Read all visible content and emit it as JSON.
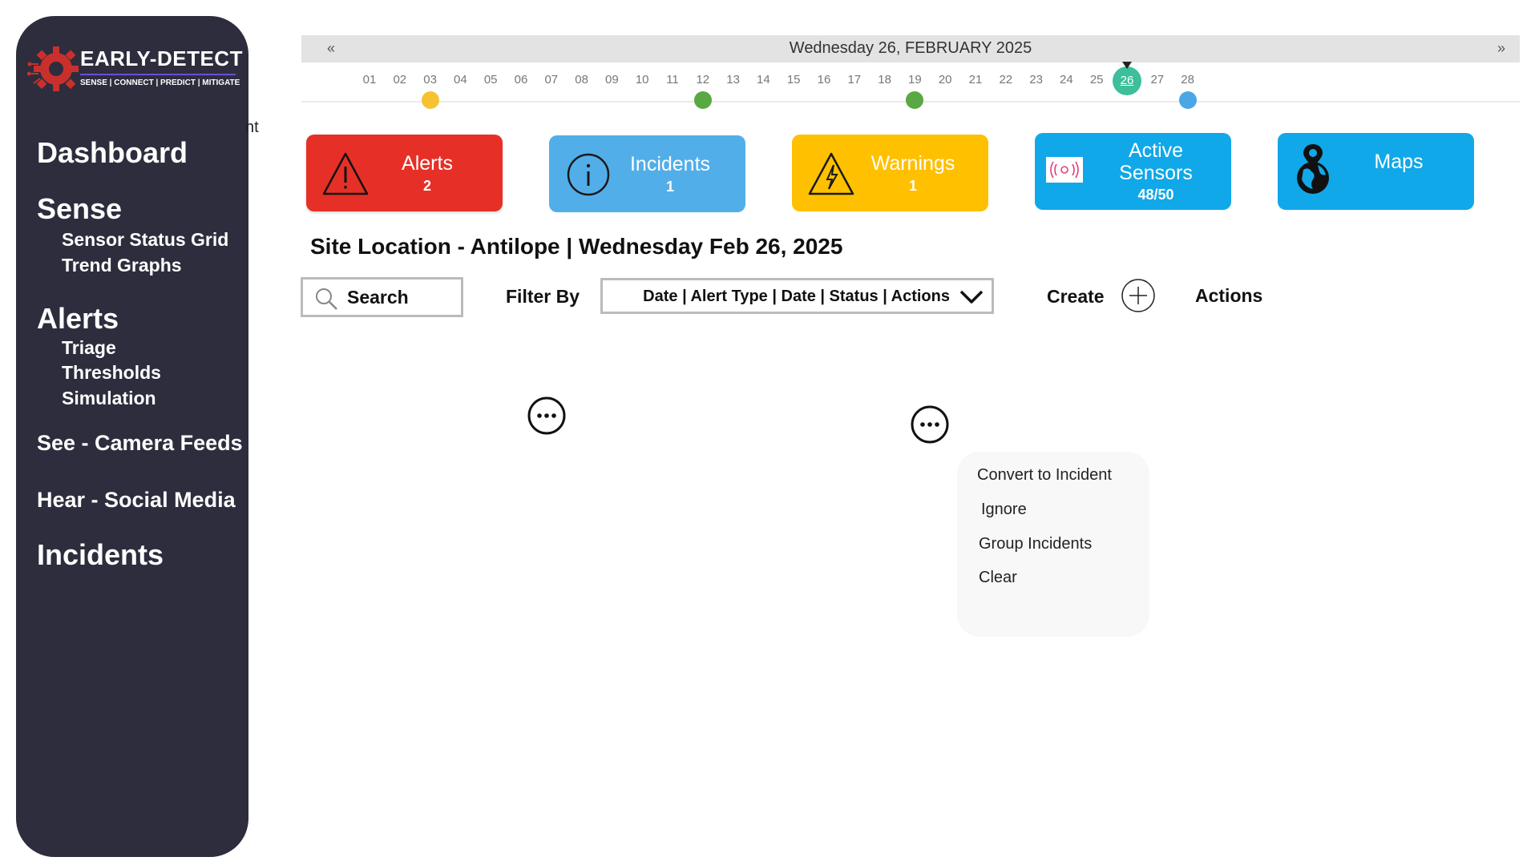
{
  "sidebar": {
    "brand": "EARLY-DETECT",
    "tagline": "SENSE | CONNECT | PREDICT | MITIGATE",
    "dashboard": "Dashboard",
    "sense": {
      "label": "Sense",
      "items": [
        "Sensor Status Grid",
        "Trend Graphs"
      ]
    },
    "alerts": {
      "label": "Alerts",
      "items": [
        "Triage",
        "Thresholds",
        "Simulation"
      ]
    },
    "see": "See - Camera Feeds",
    "hear": "Hear - Social Media",
    "incidents": "Incidents"
  },
  "stray_text": "nt",
  "calendar": {
    "prev": "«",
    "next": "»",
    "title": "Wednesday 26, FEBRUARY 2025",
    "days": [
      "01",
      "02",
      "03",
      "04",
      "05",
      "06",
      "07",
      "08",
      "09",
      "10",
      "11",
      "12",
      "13",
      "14",
      "15",
      "16",
      "17",
      "18",
      "19",
      "20",
      "21",
      "22",
      "23",
      "24",
      "25",
      "26",
      "27",
      "28"
    ],
    "selected_day": "26",
    "markers": [
      {
        "day": "03",
        "color": "#f5c232"
      },
      {
        "day": "12",
        "color": "#5aa843"
      },
      {
        "day": "19",
        "color": "#5aa843"
      },
      {
        "day": "28",
        "color": "#4aa7e6"
      }
    ]
  },
  "cards": {
    "alerts": {
      "label": "Alerts",
      "count": "2",
      "icon": "warning-triangle-icon"
    },
    "incidents": {
      "label": "Incidents",
      "count": "1",
      "icon": "info-icon"
    },
    "warnings": {
      "label": "Warnings",
      "count": "1",
      "icon": "lightning-warning-icon"
    },
    "sensors": {
      "label_1": "Active",
      "label_2": "Sensors",
      "count": "48/50",
      "icon": "sensor-signal-icon"
    },
    "maps": {
      "label": "Maps",
      "icon": "globe-pin-icon"
    }
  },
  "site_title": "Site Location - Antilope | Wednesday Feb 26, 2025",
  "toolbar": {
    "search": "Search",
    "filter_label": "Filter By",
    "filter_value": "Date | Alert Type | Date | Status | Actions",
    "create": "Create",
    "actions": "Actions"
  },
  "context_menu": [
    "Convert to Incident",
    "Ignore",
    "Group Incidents",
    "Clear"
  ]
}
